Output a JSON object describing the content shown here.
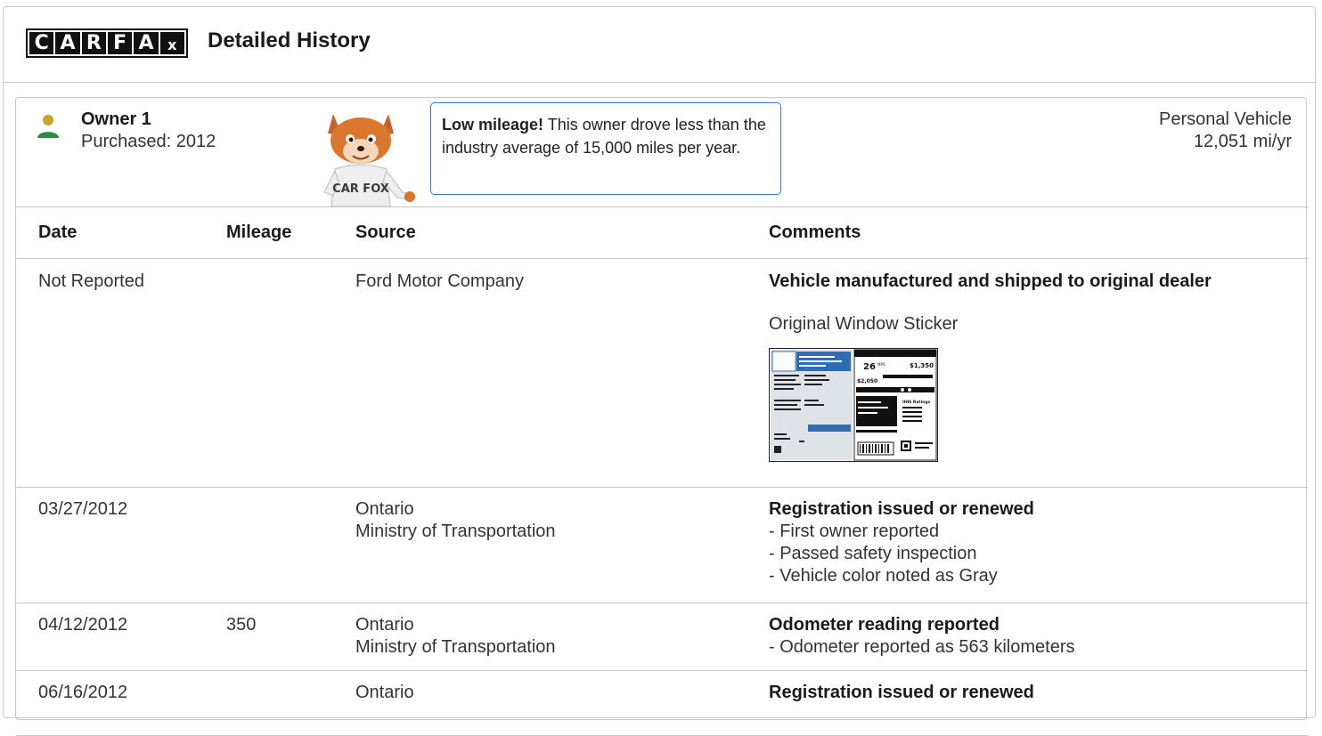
{
  "header": {
    "logo_letters": [
      "C",
      "A",
      "R",
      "F",
      "A",
      "x"
    ],
    "title": "Detailed History"
  },
  "owner": {
    "name": "Owner 1",
    "purchased": "Purchased: 2012",
    "bubble_bold": "Low mileage!",
    "bubble_text": " This owner drove less than the industry average of 15,000 miles per year.",
    "vehicle_type": "Personal Vehicle",
    "rate": "12,051 mi/yr",
    "fox_shirt": "CAR FOX"
  },
  "table": {
    "headers": [
      "Date",
      "Mileage",
      "Source",
      "Comments"
    ],
    "rows": [
      {
        "date": "Not Reported",
        "mileage": "",
        "source": [
          "Ford Motor Company"
        ],
        "title": "Vehicle manufactured and shipped to original dealer",
        "lines": [],
        "extra": "Original Window Sticker"
      },
      {
        "date": "03/27/2012",
        "mileage": "",
        "source": [
          "Ontario",
          "Ministry of Transportation"
        ],
        "title": "Registration issued or renewed",
        "lines": [
          "- First owner reported",
          "- Passed safety inspection",
          "- Vehicle color noted as Gray"
        ]
      },
      {
        "date": "04/12/2012",
        "mileage": "350",
        "source": [
          "Ontario",
          "Ministry of Transportation"
        ],
        "title": "Odometer reading reported",
        "lines": [
          "- Odometer reported as 563 kilometers"
        ]
      },
      {
        "date": "06/16/2012",
        "mileage": "",
        "source": [
          "Ontario"
        ],
        "title": "Registration issued or renewed",
        "lines": []
      }
    ]
  },
  "sticker": {
    "mpg": "26",
    "mpg_unit": "MPG",
    "save": "$1,350",
    "cost": "$2,050",
    "ratings": "IIHS Ratings"
  },
  "colors": {
    "accent_blue": "#3777bc",
    "owner_icon_head": "#c9a227",
    "owner_icon_body": "#2e8b3e",
    "border": "#c8c8c8"
  }
}
